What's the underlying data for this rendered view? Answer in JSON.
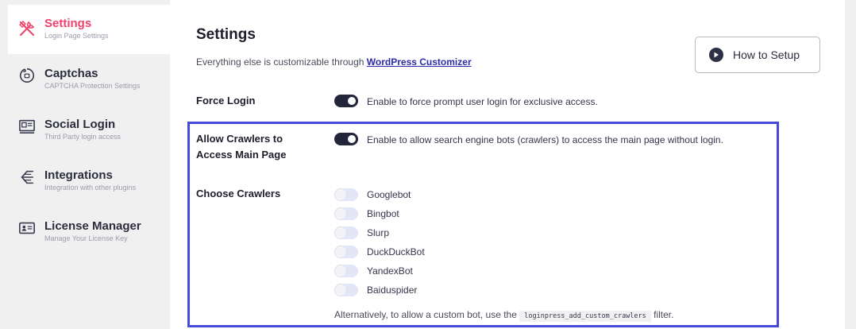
{
  "sidebar": {
    "items": [
      {
        "title": "Settings",
        "subtitle": "Login Page Settings",
        "icon": "tools-icon",
        "active": true
      },
      {
        "title": "Captchas",
        "subtitle": "CAPTCHA Protection Settings",
        "icon": "captcha-icon",
        "active": false
      },
      {
        "title": "Social Login",
        "subtitle": "Third Party login access",
        "icon": "social-card-icon",
        "active": false
      },
      {
        "title": "Integrations",
        "subtitle": "Integration with other plugins",
        "icon": "integrations-icon",
        "active": false
      },
      {
        "title": "License Manager",
        "subtitle": "Manage Your License Key",
        "icon": "license-card-icon",
        "active": false
      }
    ]
  },
  "header": {
    "title": "Settings",
    "description_prefix": "Everything else is customizable through",
    "description_link": "WordPress Customizer",
    "how_to_button": "How to Setup"
  },
  "force_login": {
    "label": "Force Login",
    "enabled": true,
    "description": "Enable to force prompt user login for exclusive access."
  },
  "allow_crawlers": {
    "label_line1": "Allow Crawlers to",
    "label_line2": "Access Main Page",
    "enabled": true,
    "description": "Enable to allow search engine bots (crawlers) to access the main page without login."
  },
  "choose_crawlers": {
    "label": "Choose Crawlers",
    "crawlers": [
      {
        "name": "Googlebot",
        "enabled": false
      },
      {
        "name": "Bingbot",
        "enabled": false
      },
      {
        "name": "Slurp",
        "enabled": false
      },
      {
        "name": "DuckDuckBot",
        "enabled": false
      },
      {
        "name": "YandexBot",
        "enabled": false
      },
      {
        "name": "Baiduspider",
        "enabled": false
      }
    ],
    "note_prefix": "Alternatively, to allow a custom bot, use the",
    "note_code": "loginpress_add_custom_crawlers",
    "note_suffix": "filter."
  },
  "colors": {
    "accent_active": "#f0416b",
    "link": "#2b2ba8",
    "highlight_border": "#4648d8",
    "toggle_on": "#23253a",
    "toggle_off": "#e3e6f4"
  }
}
